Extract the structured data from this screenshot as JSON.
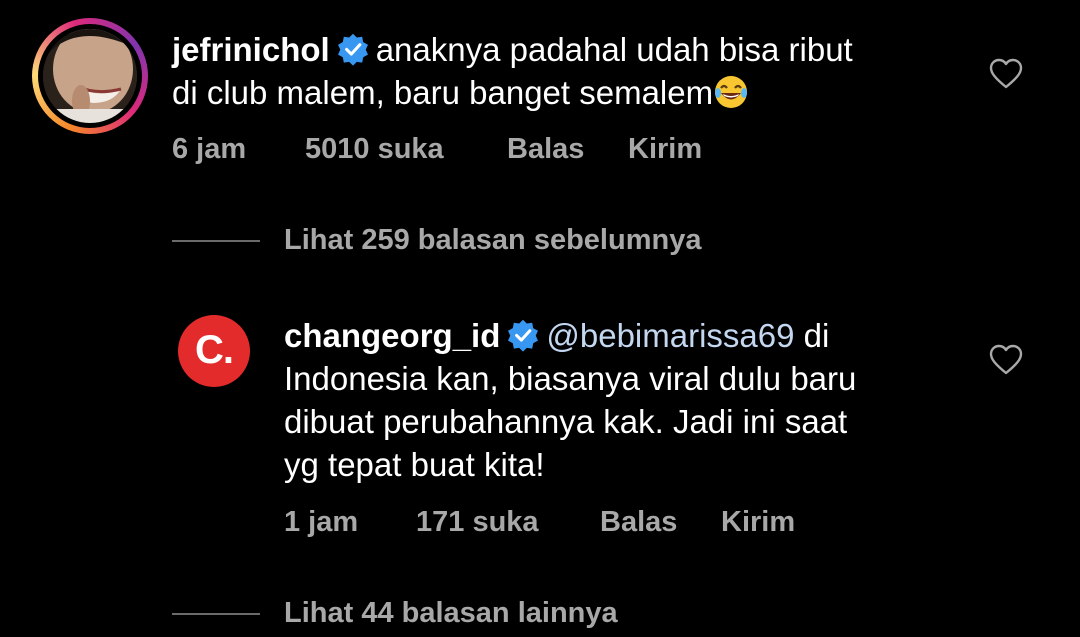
{
  "comments": [
    {
      "username": "jefrinichol",
      "verified": true,
      "text_line1": "anaknya padahal udah bisa ribut",
      "text_line2": "di club malem, baru banget semalem",
      "emoji": "😂",
      "time": "6 jam",
      "likes": "5010 suka",
      "reply_label": "Balas",
      "send_label": "Kirim",
      "avatar_icon": "user-photo-avatar",
      "has_story_ring": true
    },
    {
      "username": "changeorg_id",
      "verified": true,
      "mention": "@bebimarissa69",
      "text_line1_rest": " di",
      "text_line2": "Indonesia kan, biasanya viral dulu baru",
      "text_line3": "dibuat perubahannya kak. Jadi ini saat",
      "text_line4": "yg tepat buat kita!",
      "logo_text": "C.",
      "time": "1 jam",
      "likes": "171 suka",
      "reply_label": "Balas",
      "send_label": "Kirim"
    }
  ],
  "replies": [
    {
      "label": "Lihat 259 balasan sebelumnya"
    },
    {
      "label": "Lihat 44 balasan lainnya"
    }
  ],
  "colors": {
    "background": "#000000",
    "text": "#ffffff",
    "secondary": "#a8a8a8",
    "verified": "#3897f0",
    "mention": "#c3d8f0",
    "logo_red": "#e42b2b"
  }
}
